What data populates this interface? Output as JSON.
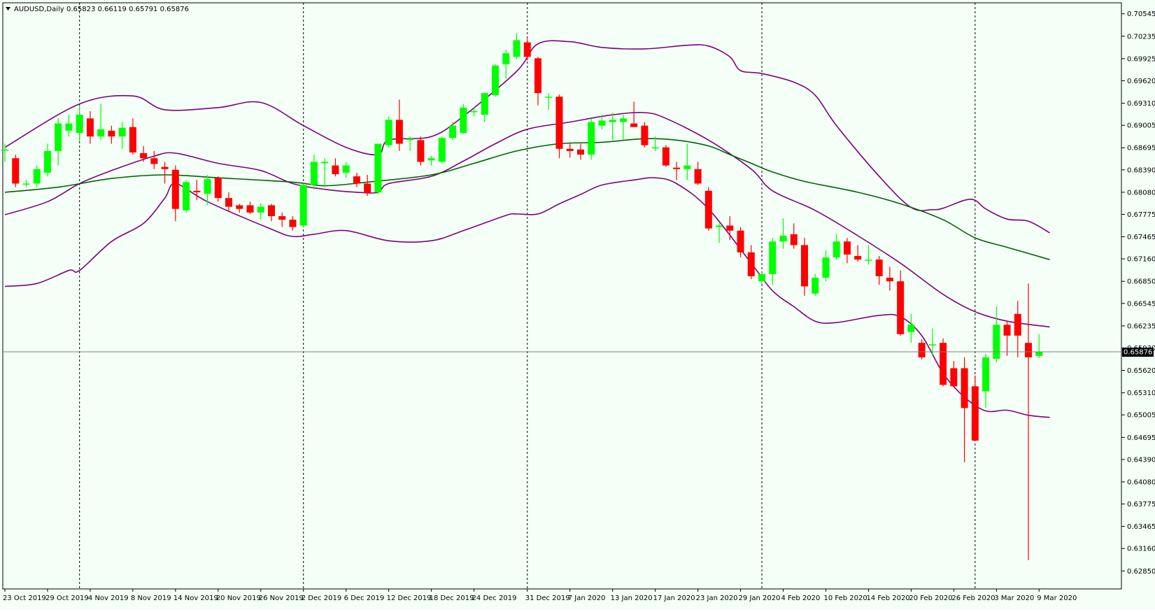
{
  "header": {
    "menu_icon": "triangle-down-icon",
    "symbol_timeframe": "AUDUSD,Daily",
    "ohlc": "0.65823 0.66119 0.65791 0.65876"
  },
  "current_price_label": "0.65876",
  "colors": {
    "background": "#f4fff7",
    "bull_candle": "#00ff00",
    "bear_candle": "#ff0000",
    "bollinger": "#800080",
    "moving_average": "#006400",
    "grid_period_separator": "#000000",
    "price_line": "#808080"
  },
  "chart_data": {
    "type": "candlestick",
    "title": "AUDUSD,Daily",
    "ylim": [
      0.6278,
      0.7065
    ],
    "y_ticks": [
      "0.70545",
      "0.70235",
      "0.69925",
      "0.69620",
      "0.69310",
      "0.69005",
      "0.68695",
      "0.68390",
      "0.68080",
      "0.67775",
      "0.67465",
      "0.67160",
      "0.66850",
      "0.66545",
      "0.66235",
      "0.65930",
      "0.65620",
      "0.65310",
      "0.65005",
      "0.64695",
      "0.64390",
      "0.64080",
      "0.63775",
      "0.63465",
      "0.63160",
      "0.62850"
    ],
    "x_tick_labels": [
      "23 Oct 2019",
      "29 Oct 2019",
      "4 Nov 2019",
      "8 Nov 2019",
      "14 Nov 2019",
      "20 Nov 2019",
      "26 Nov 2019",
      "2 Dec 2019",
      "6 Dec 2019",
      "12 Dec 2019",
      "18 Dec 2019",
      "24 Dec 2019",
      "31 Dec 2019",
      "7 Jan 2020",
      "13 Jan 2020",
      "17 Jan 2020",
      "23 Jan 2020",
      "29 Jan 2020",
      "4 Feb 2020",
      "10 Feb 2020",
      "14 Feb 2020",
      "20 Feb 2020",
      "26 Feb 2020",
      "3 Mar 2020",
      "9 Mar 2020"
    ],
    "x_tick_bar_index": [
      0,
      4,
      8,
      12,
      16,
      20,
      24,
      28,
      32,
      36,
      40,
      44,
      49,
      53,
      57,
      61,
      65,
      69,
      73,
      77,
      81,
      85,
      89,
      93,
      97
    ],
    "period_separator_bar_index": [
      7,
      28,
      49,
      71,
      91
    ],
    "candles": [
      {
        "o": 0.6867,
        "h": 0.6875,
        "l": 0.685,
        "c": 0.6867
      },
      {
        "o": 0.6855,
        "h": 0.686,
        "l": 0.6815,
        "c": 0.682
      },
      {
        "o": 0.682,
        "h": 0.6825,
        "l": 0.6815,
        "c": 0.682
      },
      {
        "o": 0.682,
        "h": 0.6845,
        "l": 0.6815,
        "c": 0.684
      },
      {
        "o": 0.6835,
        "h": 0.6875,
        "l": 0.683,
        "c": 0.6865
      },
      {
        "o": 0.6865,
        "h": 0.691,
        "l": 0.6845,
        "c": 0.6903
      },
      {
        "o": 0.6893,
        "h": 0.6915,
        "l": 0.6885,
        "c": 0.6903
      },
      {
        "o": 0.689,
        "h": 0.6928,
        "l": 0.6878,
        "c": 0.6915
      },
      {
        "o": 0.691,
        "h": 0.692,
        "l": 0.6875,
        "c": 0.6885
      },
      {
        "o": 0.6885,
        "h": 0.693,
        "l": 0.688,
        "c": 0.6895
      },
      {
        "o": 0.6893,
        "h": 0.69,
        "l": 0.6875,
        "c": 0.6885
      },
      {
        "o": 0.6885,
        "h": 0.6905,
        "l": 0.6868,
        "c": 0.6897
      },
      {
        "o": 0.6898,
        "h": 0.691,
        "l": 0.686,
        "c": 0.6863
      },
      {
        "o": 0.6862,
        "h": 0.6872,
        "l": 0.685,
        "c": 0.6855
      },
      {
        "o": 0.6855,
        "h": 0.6865,
        "l": 0.684,
        "c": 0.6847
      },
      {
        "o": 0.6843,
        "h": 0.685,
        "l": 0.682,
        "c": 0.684
      },
      {
        "o": 0.6839,
        "h": 0.6845,
        "l": 0.6768,
        "c": 0.6785
      },
      {
        "o": 0.6783,
        "h": 0.6825,
        "l": 0.678,
        "c": 0.6822
      },
      {
        "o": 0.681,
        "h": 0.6825,
        "l": 0.6797,
        "c": 0.6808
      },
      {
        "o": 0.6806,
        "h": 0.6832,
        "l": 0.679,
        "c": 0.6826
      },
      {
        "o": 0.6828,
        "h": 0.683,
        "l": 0.6795,
        "c": 0.68
      },
      {
        "o": 0.68,
        "h": 0.6808,
        "l": 0.6782,
        "c": 0.6788
      },
      {
        "o": 0.679,
        "h": 0.6792,
        "l": 0.678,
        "c": 0.6785
      },
      {
        "o": 0.679,
        "h": 0.6795,
        "l": 0.6778,
        "c": 0.678
      },
      {
        "o": 0.678,
        "h": 0.6793,
        "l": 0.677,
        "c": 0.6788
      },
      {
        "o": 0.679,
        "h": 0.6792,
        "l": 0.6768,
        "c": 0.6775
      },
      {
        "o": 0.6775,
        "h": 0.678,
        "l": 0.676,
        "c": 0.677
      },
      {
        "o": 0.677,
        "h": 0.6775,
        "l": 0.6755,
        "c": 0.676
      },
      {
        "o": 0.6762,
        "h": 0.682,
        "l": 0.676,
        "c": 0.6818
      },
      {
        "o": 0.6818,
        "h": 0.686,
        "l": 0.6812,
        "c": 0.685
      },
      {
        "o": 0.6848,
        "h": 0.6855,
        "l": 0.6815,
        "c": 0.685
      },
      {
        "o": 0.6845,
        "h": 0.6855,
        "l": 0.683,
        "c": 0.6833
      },
      {
        "o": 0.6835,
        "h": 0.685,
        "l": 0.6828,
        "c": 0.6845
      },
      {
        "o": 0.683,
        "h": 0.6835,
        "l": 0.6815,
        "c": 0.682
      },
      {
        "o": 0.682,
        "h": 0.6832,
        "l": 0.6803,
        "c": 0.6807
      },
      {
        "o": 0.6808,
        "h": 0.6875,
        "l": 0.6805,
        "c": 0.6875
      },
      {
        "o": 0.6873,
        "h": 0.6913,
        "l": 0.687,
        "c": 0.6908
      },
      {
        "o": 0.6908,
        "h": 0.6936,
        "l": 0.6865,
        "c": 0.6875
      },
      {
        "o": 0.688,
        "h": 0.6885,
        "l": 0.6865,
        "c": 0.6882
      },
      {
        "o": 0.688,
        "h": 0.6885,
        "l": 0.6845,
        "c": 0.685
      },
      {
        "o": 0.6852,
        "h": 0.6858,
        "l": 0.6845,
        "c": 0.6855
      },
      {
        "o": 0.685,
        "h": 0.6885,
        "l": 0.6848,
        "c": 0.6883
      },
      {
        "o": 0.6883,
        "h": 0.6905,
        "l": 0.688,
        "c": 0.69
      },
      {
        "o": 0.689,
        "h": 0.693,
        "l": 0.6888,
        "c": 0.6925
      },
      {
        "o": 0.692,
        "h": 0.6925,
        "l": 0.6913,
        "c": 0.692
      },
      {
        "o": 0.6915,
        "h": 0.6945,
        "l": 0.6905,
        "c": 0.6945
      },
      {
        "o": 0.6942,
        "h": 0.6985,
        "l": 0.694,
        "c": 0.6983
      },
      {
        "o": 0.6985,
        "h": 0.7005,
        "l": 0.6965,
        "c": 0.7
      },
      {
        "o": 0.6995,
        "h": 0.7028,
        "l": 0.6992,
        "c": 0.7018
      },
      {
        "o": 0.7015,
        "h": 0.702,
        "l": 0.699,
        "c": 0.6995
      },
      {
        "o": 0.6993,
        "h": 0.6995,
        "l": 0.6928,
        "c": 0.6945
      },
      {
        "o": 0.694,
        "h": 0.6945,
        "l": 0.6922,
        "c": 0.694
      },
      {
        "o": 0.694,
        "h": 0.6943,
        "l": 0.6855,
        "c": 0.6868
      },
      {
        "o": 0.6868,
        "h": 0.6875,
        "l": 0.6856,
        "c": 0.6865
      },
      {
        "o": 0.6867,
        "h": 0.6875,
        "l": 0.6853,
        "c": 0.686
      },
      {
        "o": 0.686,
        "h": 0.691,
        "l": 0.6853,
        "c": 0.6905
      },
      {
        "o": 0.69,
        "h": 0.6915,
        "l": 0.6895,
        "c": 0.6907
      },
      {
        "o": 0.6905,
        "h": 0.6918,
        "l": 0.688,
        "c": 0.6908
      },
      {
        "o": 0.6905,
        "h": 0.6915,
        "l": 0.688,
        "c": 0.691
      },
      {
        "o": 0.6903,
        "h": 0.6933,
        "l": 0.69,
        "c": 0.6898
      },
      {
        "o": 0.69,
        "h": 0.6905,
        "l": 0.687,
        "c": 0.6873
      },
      {
        "o": 0.687,
        "h": 0.6885,
        "l": 0.6865,
        "c": 0.687
      },
      {
        "o": 0.687,
        "h": 0.6873,
        "l": 0.6843,
        "c": 0.6845
      },
      {
        "o": 0.6842,
        "h": 0.685,
        "l": 0.6825,
        "c": 0.684
      },
      {
        "o": 0.684,
        "h": 0.6875,
        "l": 0.6825,
        "c": 0.6845
      },
      {
        "o": 0.684,
        "h": 0.685,
        "l": 0.6818,
        "c": 0.682
      },
      {
        "o": 0.681,
        "h": 0.6815,
        "l": 0.6755,
        "c": 0.6758
      },
      {
        "o": 0.676,
        "h": 0.6765,
        "l": 0.6738,
        "c": 0.6762
      },
      {
        "o": 0.6762,
        "h": 0.6775,
        "l": 0.6742,
        "c": 0.6755
      },
      {
        "o": 0.6755,
        "h": 0.676,
        "l": 0.6718,
        "c": 0.6725
      },
      {
        "o": 0.6725,
        "h": 0.6735,
        "l": 0.6688,
        "c": 0.6692
      },
      {
        "o": 0.6685,
        "h": 0.6697,
        "l": 0.6682,
        "c": 0.6695
      },
      {
        "o": 0.6695,
        "h": 0.6745,
        "l": 0.668,
        "c": 0.674
      },
      {
        "o": 0.674,
        "h": 0.6772,
        "l": 0.673,
        "c": 0.6748
      },
      {
        "o": 0.675,
        "h": 0.6765,
        "l": 0.673,
        "c": 0.6735
      },
      {
        "o": 0.6735,
        "h": 0.6745,
        "l": 0.6665,
        "c": 0.6678
      },
      {
        "o": 0.6668,
        "h": 0.6695,
        "l": 0.6665,
        "c": 0.669
      },
      {
        "o": 0.669,
        "h": 0.6728,
        "l": 0.6685,
        "c": 0.6718
      },
      {
        "o": 0.6718,
        "h": 0.675,
        "l": 0.6715,
        "c": 0.674
      },
      {
        "o": 0.674,
        "h": 0.6745,
        "l": 0.671,
        "c": 0.6722
      },
      {
        "o": 0.672,
        "h": 0.6735,
        "l": 0.6712,
        "c": 0.6715
      },
      {
        "o": 0.6715,
        "h": 0.6735,
        "l": 0.6708,
        "c": 0.6715
      },
      {
        "o": 0.6715,
        "h": 0.672,
        "l": 0.668,
        "c": 0.6692
      },
      {
        "o": 0.669,
        "h": 0.6705,
        "l": 0.6672,
        "c": 0.6685
      },
      {
        "o": 0.6685,
        "h": 0.67,
        "l": 0.661,
        "c": 0.6612
      },
      {
        "o": 0.6615,
        "h": 0.664,
        "l": 0.66,
        "c": 0.6625
      },
      {
        "o": 0.66,
        "h": 0.6605,
        "l": 0.6577,
        "c": 0.658
      },
      {
        "o": 0.6598,
        "h": 0.662,
        "l": 0.6582,
        "c": 0.6598
      },
      {
        "o": 0.66,
        "h": 0.6606,
        "l": 0.654,
        "c": 0.6542
      },
      {
        "o": 0.6565,
        "h": 0.6575,
        "l": 0.654,
        "c": 0.654
      },
      {
        "o": 0.6565,
        "h": 0.658,
        "l": 0.6435,
        "c": 0.651
      },
      {
        "o": 0.654,
        "h": 0.6555,
        "l": 0.6465,
        "c": 0.6465
      },
      {
        "o": 0.6533,
        "h": 0.6585,
        "l": 0.651,
        "c": 0.658
      },
      {
        "o": 0.6578,
        "h": 0.665,
        "l": 0.6573,
        "c": 0.6625
      },
      {
        "o": 0.6625,
        "h": 0.663,
        "l": 0.6582,
        "c": 0.661
      },
      {
        "o": 0.664,
        "h": 0.6658,
        "l": 0.658,
        "c": 0.661
      },
      {
        "o": 0.66,
        "h": 0.6682,
        "l": 0.63,
        "c": 0.658
      },
      {
        "o": 0.6582,
        "h": 0.6612,
        "l": 0.6579,
        "c": 0.6588
      }
    ],
    "series": [
      {
        "style": "bollinger",
        "anchors": [
          [
            0,
            0.687
          ],
          [
            7,
            0.693
          ],
          [
            12,
            0.6941
          ],
          [
            15,
            0.6922
          ],
          [
            20,
            0.6925
          ],
          [
            24,
            0.6932
          ],
          [
            28,
            0.69
          ],
          [
            32,
            0.687
          ],
          [
            35,
            0.686
          ],
          [
            36,
            0.688
          ],
          [
            40,
            0.6885
          ],
          [
            43,
            0.6913
          ],
          [
            48,
            0.6975
          ],
          [
            50,
            0.7013
          ],
          [
            53,
            0.7016
          ],
          [
            56,
            0.7008
          ],
          [
            60,
            0.7006
          ],
          [
            64,
            0.7011
          ],
          [
            66,
            0.701
          ],
          [
            68,
            0.6995
          ],
          [
            69,
            0.6976
          ],
          [
            71,
            0.6972
          ],
          [
            74,
            0.696
          ],
          [
            76,
            0.6942
          ],
          [
            78,
            0.69
          ],
          [
            82,
            0.683
          ],
          [
            85,
            0.6787
          ],
          [
            87,
            0.6784
          ],
          [
            88,
            0.6786
          ],
          [
            90,
            0.6797
          ],
          [
            91,
            0.6797
          ],
          [
            92,
            0.6785
          ],
          [
            94,
            0.6771
          ],
          [
            96,
            0.6768
          ],
          [
            98,
            0.6752
          ]
        ]
      },
      {
        "style": "bollinger",
        "anchors": [
          [
            0,
            0.6777
          ],
          [
            4,
            0.6795
          ],
          [
            7,
            0.682
          ],
          [
            10,
            0.6838
          ],
          [
            14,
            0.6858
          ],
          [
            16,
            0.6862
          ],
          [
            20,
            0.6848
          ],
          [
            24,
            0.6838
          ],
          [
            27,
            0.682
          ],
          [
            30,
            0.6812
          ],
          [
            33,
            0.6808
          ],
          [
            35,
            0.6808
          ],
          [
            36,
            0.682
          ],
          [
            40,
            0.683
          ],
          [
            43,
            0.6851
          ],
          [
            46,
            0.6875
          ],
          [
            49,
            0.6895
          ],
          [
            53,
            0.6905
          ],
          [
            57,
            0.6915
          ],
          [
            60,
            0.6918
          ],
          [
            62,
            0.691
          ],
          [
            66,
            0.688
          ],
          [
            70,
            0.684
          ],
          [
            72,
            0.681
          ],
          [
            76,
            0.6783
          ],
          [
            80,
            0.6748
          ],
          [
            84,
            0.671
          ],
          [
            88,
            0.6667
          ],
          [
            91,
            0.6643
          ],
          [
            94,
            0.663
          ],
          [
            98,
            0.6622
          ]
        ]
      },
      {
        "style": "bollinger",
        "anchors": [
          [
            0,
            0.6678
          ],
          [
            3,
            0.6682
          ],
          [
            6,
            0.67
          ],
          [
            7,
            0.67
          ],
          [
            10,
            0.674
          ],
          [
            13,
            0.6765
          ],
          [
            15,
            0.68
          ],
          [
            16,
            0.682
          ],
          [
            19,
            0.6795
          ],
          [
            25,
            0.6757
          ],
          [
            27,
            0.6747
          ],
          [
            29,
            0.675
          ],
          [
            32,
            0.6755
          ],
          [
            36,
            0.6741
          ],
          [
            40,
            0.6741
          ],
          [
            43,
            0.6755
          ],
          [
            47,
            0.6776
          ],
          [
            48,
            0.6778
          ],
          [
            50,
            0.6778
          ],
          [
            52,
            0.6792
          ],
          [
            54,
            0.6805
          ],
          [
            56,
            0.6818
          ],
          [
            59,
            0.6825
          ],
          [
            61,
            0.6828
          ],
          [
            63,
            0.682
          ],
          [
            66,
            0.6785
          ],
          [
            70,
            0.671
          ],
          [
            72,
            0.6672
          ],
          [
            74,
            0.665
          ],
          [
            76,
            0.663
          ],
          [
            78,
            0.6628
          ],
          [
            82,
            0.6638
          ],
          [
            84,
            0.6636
          ],
          [
            86,
            0.661
          ],
          [
            88,
            0.6558
          ],
          [
            90,
            0.6525
          ],
          [
            92,
            0.6506
          ],
          [
            94,
            0.6507
          ],
          [
            96,
            0.65
          ],
          [
            98,
            0.6497
          ]
        ]
      },
      {
        "style": "ma",
        "anchors": [
          [
            0,
            0.6808
          ],
          [
            5,
            0.6815
          ],
          [
            10,
            0.6827
          ],
          [
            15,
            0.6832
          ],
          [
            20,
            0.6828
          ],
          [
            27,
            0.6822
          ],
          [
            30,
            0.6817
          ],
          [
            34,
            0.6822
          ],
          [
            40,
            0.6832
          ],
          [
            44,
            0.6848
          ],
          [
            48,
            0.6865
          ],
          [
            52,
            0.6875
          ],
          [
            56,
            0.6877
          ],
          [
            60,
            0.6882
          ],
          [
            63,
            0.688
          ],
          [
            66,
            0.6872
          ],
          [
            68,
            0.686
          ],
          [
            70,
            0.6848
          ],
          [
            72,
            0.6836
          ],
          [
            75,
            0.6823
          ],
          [
            80,
            0.6808
          ],
          [
            84,
            0.6792
          ],
          [
            88,
            0.677
          ],
          [
            91,
            0.6745
          ],
          [
            94,
            0.6732
          ],
          [
            98,
            0.6715
          ]
        ]
      }
    ]
  }
}
